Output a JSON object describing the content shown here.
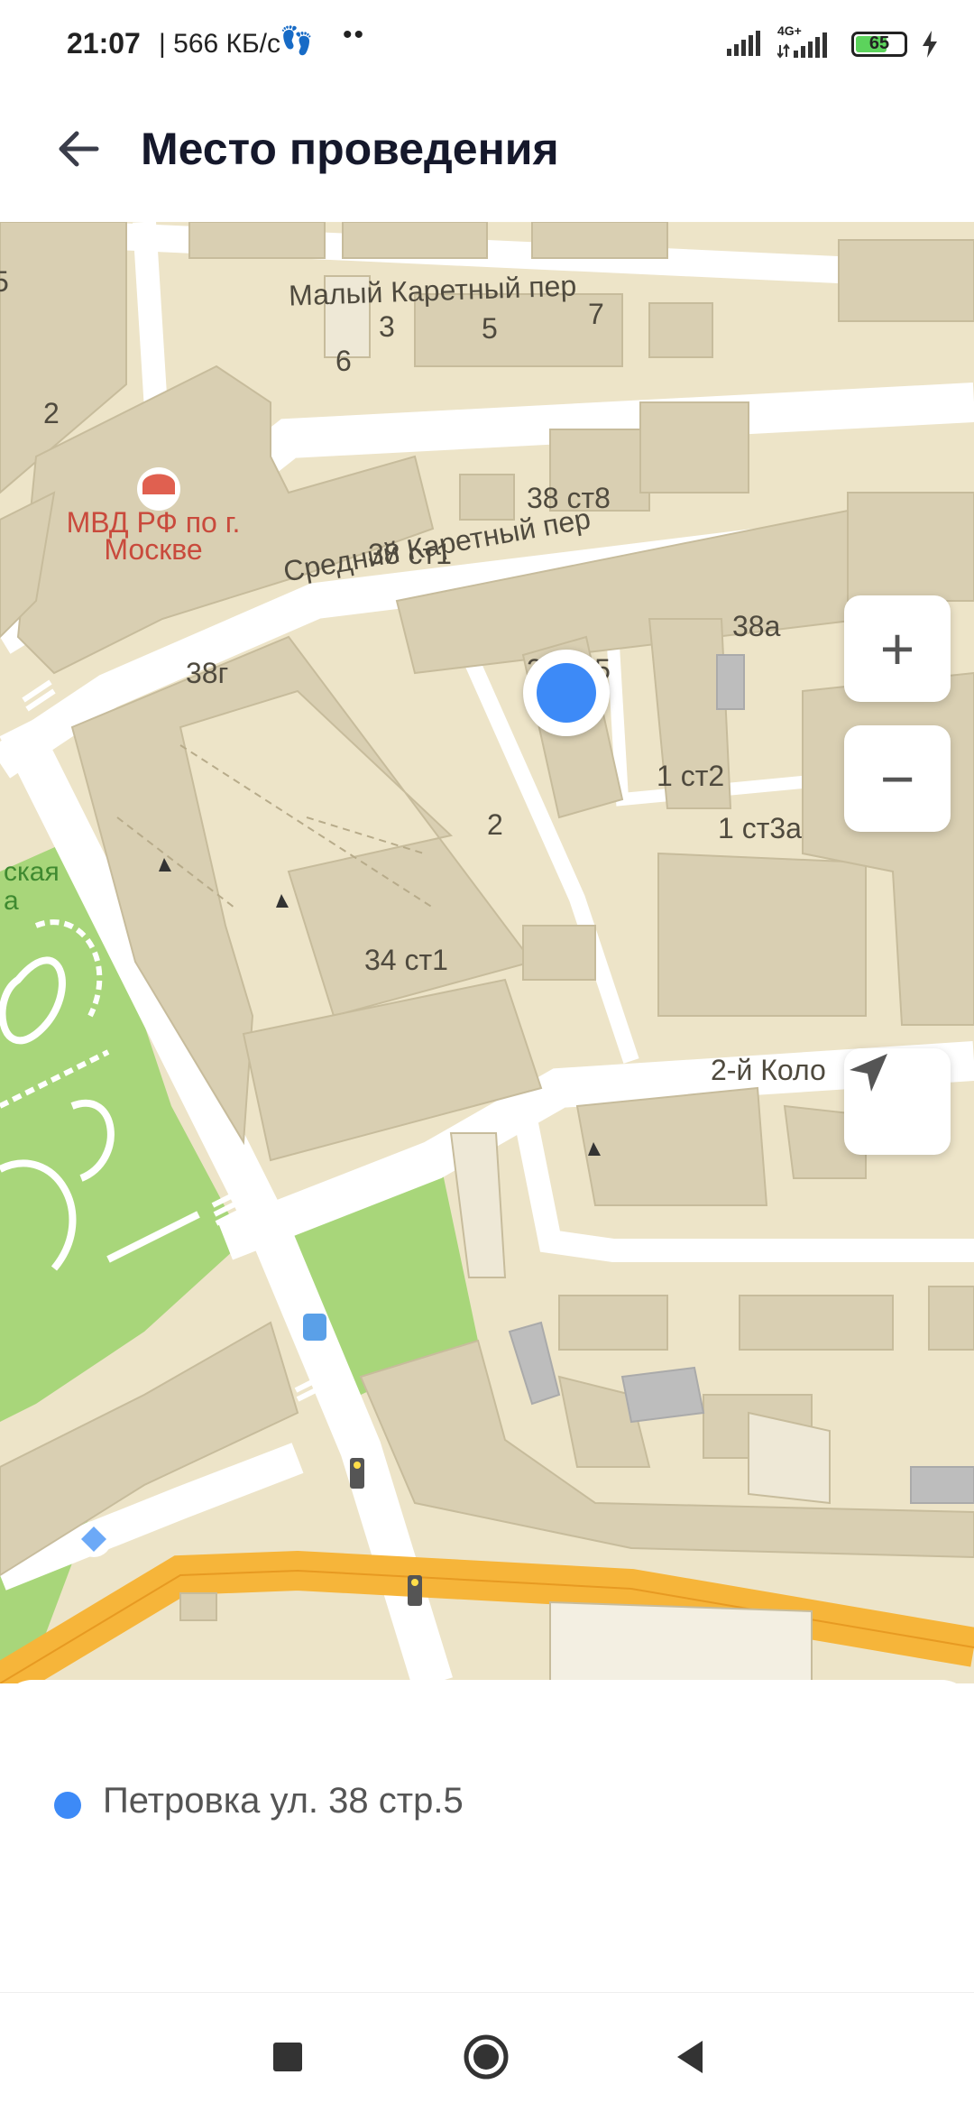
{
  "status_bar": {
    "time": "21:07",
    "speed": "| 566 КБ/с",
    "network": "4G+",
    "battery": "65",
    "battery_level": 0.65
  },
  "header": {
    "title": "Место проведения",
    "back_icon": "arrow-left-icon"
  },
  "map": {
    "street_labels": {
      "maly_karetny": "Малый Каретный пер",
      "sredny_karetny": "Средний Каретный пер",
      "kolobovsky": "2-й Коло"
    },
    "building_numbers": {
      "b6": "6",
      "b5a": "5",
      "b3": "3",
      "b5b": "5",
      "b7": "7",
      "b2a": "2",
      "b38st8": "38 ст8",
      "b38st1": "38 ст1",
      "b38a": "38а",
      "b38g": "38г",
      "b38st5": "38 ст5",
      "b1st2": "1 ст2",
      "b1st3a": "1 ст3а",
      "b2b": "2",
      "b34st1": "34 ст1"
    },
    "poi_labels": {
      "mvd": "МВД РФ по г. Москве",
      "park_part1": "ская",
      "park_part2": "а"
    },
    "controls": {
      "zoom_in": "+",
      "zoom_out": "−",
      "locate_icon": "navigation-arrow-icon"
    },
    "colors": {
      "background": "#ede4c8",
      "building": "#d9cfb2",
      "road": "#ffffff",
      "park": "#a8d67a",
      "main_road": "#f6b53a",
      "marker": "#3d8af7"
    }
  },
  "location": {
    "address": "Петровка ул. 38 стр.5"
  },
  "nav_bar": {
    "recents_icon": "square-icon",
    "home_icon": "circle-icon",
    "back_icon": "triangle-back-icon"
  }
}
